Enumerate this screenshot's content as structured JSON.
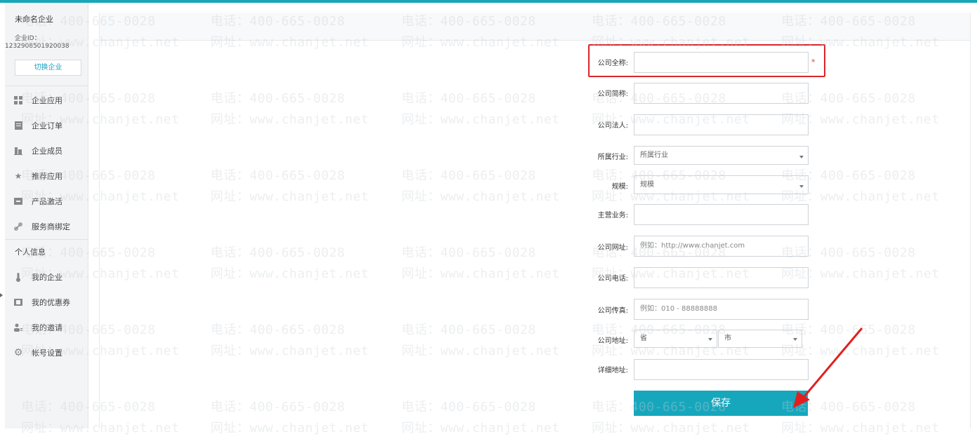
{
  "sidebar": {
    "company_name": "未命名企业",
    "company_id_label": "企业ID：",
    "company_id": "1232908501920038",
    "switch_label": "切换企业",
    "items": [
      {
        "label": "企业应用",
        "icon": "grid-icon"
      },
      {
        "label": "企业订单",
        "icon": "order-icon"
      },
      {
        "label": "企业成员",
        "icon": "members-icon"
      },
      {
        "label": "推荐应用",
        "icon": "star-icon"
      },
      {
        "label": "产品激活",
        "icon": "activate-icon"
      },
      {
        "label": "服务商绑定",
        "icon": "link-icon"
      }
    ],
    "personal_section": "个人信息",
    "personal_items": [
      {
        "label": "我的企业",
        "icon": "thermometer-icon"
      },
      {
        "label": "我的优惠券",
        "icon": "coupon-icon"
      },
      {
        "label": "我的邀请",
        "icon": "invite-icon"
      },
      {
        "label": "帐号设置",
        "icon": "gear-icon"
      }
    ]
  },
  "form": {
    "full_name_label": "公司全称:",
    "full_name_value": "",
    "required_mark": "*",
    "short_name_label": "公司简称:",
    "short_name_value": "",
    "legal_label": "公司法人:",
    "legal_value": "",
    "industry_label": "所属行业:",
    "industry_value": "所属行业",
    "scale_label": "规模:",
    "scale_value": "规模",
    "business_label": "主营业务:",
    "business_value": "",
    "website_label": "公司网址:",
    "website_placeholder": "例如：http://www.chanjet.com",
    "phone_label": "公司电话:",
    "phone_value": "",
    "fax_label": "公司传真:",
    "fax_placeholder": "例如：010 - 88888888",
    "address_label": "公司地址:",
    "province_value": "省",
    "city_value": "市",
    "detail_label": "详细地址:",
    "detail_value": "",
    "save_label": "保存"
  },
  "watermark": {
    "phone": "电话：400-665-0028",
    "site": "网址：www.chanjet.net"
  },
  "colors": {
    "accent": "#16a7bd",
    "highlight": "#d9262b",
    "arrow": "#e02020"
  }
}
